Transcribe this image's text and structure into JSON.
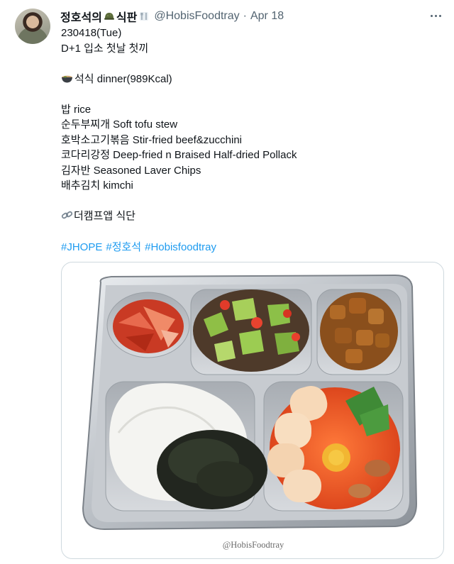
{
  "tweet": {
    "display_name": "정호석의",
    "display_name_suffix": "식판",
    "handle": "@HobisFoodtray",
    "separator": "·",
    "date": "Apr 18",
    "lines": {
      "date_code": "230418(Tue)",
      "subtitle": "D+1 입소 첫날 첫끼",
      "meal_header": "석식 dinner(989Kcal)",
      "items": [
        "밥 rice",
        "순두부찌개 Soft tofu stew",
        "호박소고기볶음 Stir-fried beef&zucchini",
        "코다리강정 Deep-fried n Braised Half-dried Pollack",
        "김자반 Seasoned Laver Chips",
        "배추김치 kimchi"
      ],
      "link_text": "더캠프앱 식단"
    },
    "hashtags": [
      "#JHOPE",
      "#정호석",
      "#Hobisfoodtray"
    ],
    "media_watermark": "@HobisFoodtray"
  },
  "icons": {
    "name_emoji_1": "military-helmet-icon",
    "name_emoji_2": "fork-knife-plate-icon",
    "meal_emoji": "bowl-icon",
    "link_emoji": "link-icon",
    "more": "more-options-icon"
  },
  "colors": {
    "link_blue": "#1d9bf0",
    "secondary_text": "#536471",
    "border": "#cfd9de"
  }
}
